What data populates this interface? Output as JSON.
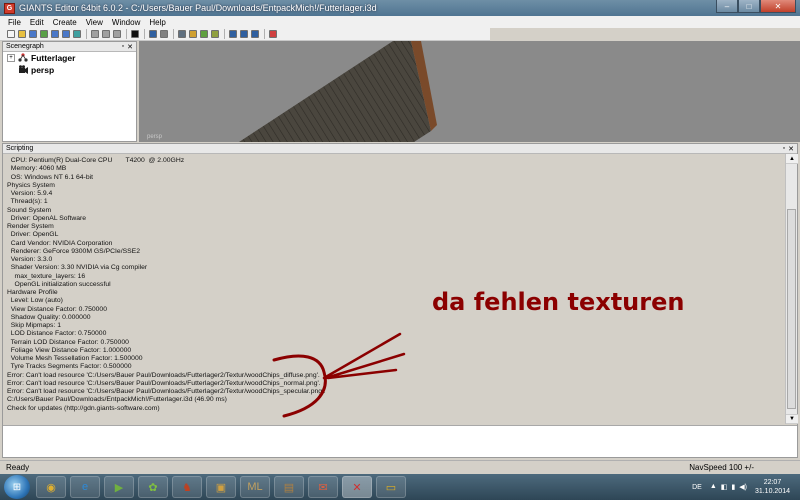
{
  "window": {
    "title": "GIANTS Editor 64bit 6.0.2 - C:/Users/Bauer Paul/Downloads/EntpackMich!/Futterlager.i3d",
    "app_icon_label": "G",
    "buttons": {
      "minimize": "–",
      "maximize": "□",
      "close": "✕"
    }
  },
  "menu": {
    "items": [
      "File",
      "Edit",
      "Create",
      "View",
      "Window",
      "Help"
    ]
  },
  "toolbar": {
    "icons": [
      {
        "name": "new-file-icon",
        "color": "#f5f5f5"
      },
      {
        "name": "open-folder-icon",
        "color": "#e8c040"
      },
      {
        "name": "save-icon",
        "color": "#4a78c8"
      },
      {
        "name": "import-icon",
        "color": "#5aa048"
      },
      {
        "name": "export-icon",
        "color": "#4a78c8"
      },
      {
        "name": "save-as-icon",
        "color": "#4a78c8"
      },
      {
        "name": "reload-icon",
        "color": "#40a0a0"
      },
      {
        "name": "undo-icon",
        "color": "#a0a0a0"
      },
      {
        "name": "redo-icon",
        "color": "#a0a0a0"
      },
      {
        "name": "delete-icon",
        "color": "#a0a0a0"
      },
      {
        "name": "play-icon",
        "color": "#101010"
      },
      {
        "name": "select-icon",
        "color": "#3060a0"
      },
      {
        "name": "snap-icon",
        "color": "#808080"
      },
      {
        "name": "camera-icon",
        "color": "#607080"
      },
      {
        "name": "terrain-paint-icon",
        "color": "#d0a030"
      },
      {
        "name": "foliage-paint-icon",
        "color": "#60a040"
      },
      {
        "name": "terrain-sculpt-icon",
        "color": "#90a040"
      },
      {
        "name": "move-icon",
        "color": "#3060a0"
      },
      {
        "name": "rotate-icon",
        "color": "#3060a0"
      },
      {
        "name": "scale-icon",
        "color": "#3060a0"
      },
      {
        "name": "bookmark-icon",
        "color": "#d04040"
      }
    ]
  },
  "scenegraph": {
    "title": "Scenegraph",
    "header_buttons": {
      "float": "▫",
      "close": "✕"
    },
    "items": [
      {
        "label": "Futterlager",
        "expander": "+",
        "icon": "transform-group-icon"
      },
      {
        "label": "persp",
        "expander": "",
        "icon": "camera-icon"
      }
    ]
  },
  "viewport": {
    "camera_label": "persp"
  },
  "scripting": {
    "title": "Scripting",
    "header_buttons": {
      "float": "▫",
      "close": "✕"
    },
    "log_lines": [
      "  CPU: Pentium(R) Dual-Core CPU       T4200  @ 2.00GHz",
      "  Memory: 4060 MB",
      "  OS: Windows NT 6.1 64-bit",
      "Physics System",
      "  Version: 5.9.4",
      "  Thread(s): 1",
      "Sound System",
      "  Driver: OpenAL Software",
      "Render System",
      "  Driver: OpenGL",
      "  Card Vendor: NVIDIA Corporation",
      "  Renderer: GeForce 9300M GS/PCIe/SSE2",
      "  Version: 3.3.0",
      "  Shader Version: 3.30 NVIDIA via Cg compiler",
      "    max_texture_layers: 16",
      "    OpenGL initialization successful",
      "Hardware Profile",
      "  Level: Low (auto)",
      "  View Distance Factor: 0.750000",
      "  Shadow Quality: 0.000000",
      "  Skip Mipmaps: 1",
      "  LOD Distance Factor: 0.750000",
      "  Terrain LOD Distance Factor: 0.750000",
      "  Foliage View Distance Factor: 1.000000",
      "  Volume Mesh Tessellation Factor: 1.500000",
      "  Tyre Tracks Segments Factor: 0.500000",
      "Error: Can't load resource 'C:/Users/Bauer Paul/Downloads/Futterlager2/Textur/woodChips_diffuse.png'.",
      "Error: Can't load resource 'C:/Users/Bauer Paul/Downloads/Futterlager2/Textur/woodChips_normal.png'.",
      "Error: Can't load resource 'C:/Users/Bauer Paul/Downloads/Futterlager2/Textur/woodChips_specular.png'.",
      "C:/Users/Bauer Paul/Downloads/EntpackMich!/Futterlager.i3d (46.90 ms)",
      "Check for updates (http://gdn.giants-software.com)"
    ],
    "annotation": "da fehlen texturen",
    "annotation_color": "#8b0000",
    "scroll": {
      "up": "▲",
      "down": "▼"
    }
  },
  "status": {
    "left": "Ready",
    "nav_speed": "NavSpeed 100 +/-"
  },
  "taskbar": {
    "start_icon": "windows-orb-icon",
    "apps": [
      {
        "name": "chrome-icon",
        "glyph": "◉",
        "color": "#e0b030"
      },
      {
        "name": "internet-explorer-icon",
        "glyph": "e",
        "color": "#2e8ad8"
      },
      {
        "name": "media-icon",
        "glyph": "▶",
        "color": "#70b040"
      },
      {
        "name": "farming-sim-icon",
        "glyph": "✿",
        "color": "#80c040"
      },
      {
        "name": "game-icon-1",
        "glyph": "♞",
        "color": "#c04020"
      },
      {
        "name": "game-icon-2",
        "glyph": "▣",
        "color": "#d0a040"
      },
      {
        "name": "ml-icon",
        "glyph": "ML",
        "color": "#c0a060"
      },
      {
        "name": "archive-icon",
        "glyph": "▤",
        "color": "#b08040"
      },
      {
        "name": "mail-icon",
        "glyph": "✉",
        "color": "#e06040"
      },
      {
        "name": "giants-editor-icon",
        "glyph": "✕",
        "color": "#d03030"
      },
      {
        "name": "folder-icon",
        "glyph": "▭",
        "color": "#e0b020"
      }
    ],
    "active_index": 9,
    "language": "DE",
    "tray_icons": [
      "▲",
      "◧",
      "▮",
      "◀)"
    ],
    "time": "22:07",
    "date": "31.10.2014"
  }
}
